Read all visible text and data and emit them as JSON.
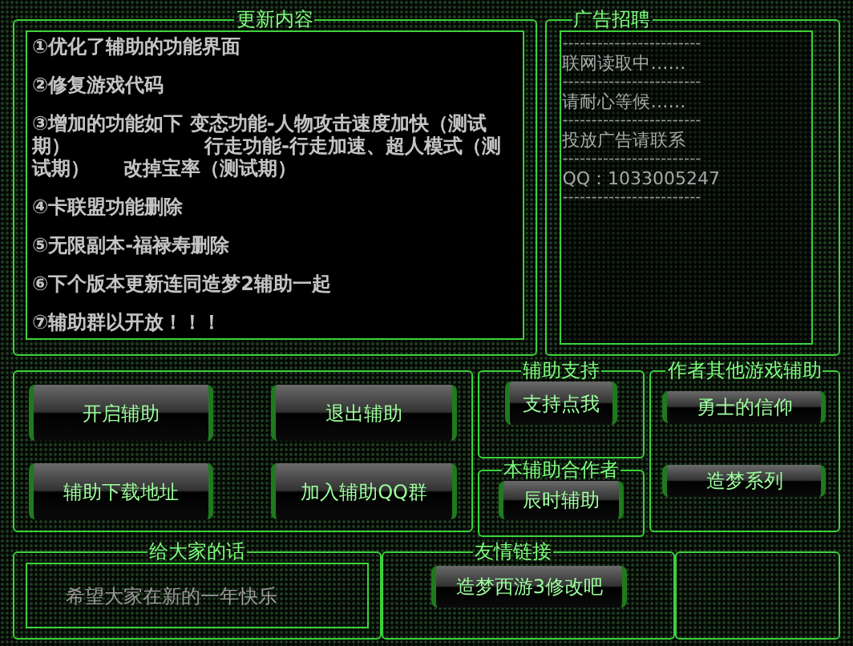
{
  "update_panel": {
    "title": "更新内容",
    "items": [
      "①优化了辅助的功能界面",
      "②修复游戏代码",
      "③增加的功能如下 变态功能-人物攻击速度加快（测试期）                    行走功能-行走加速、超人模式（测试期）     改掉宝率（测试期）",
      "④卡联盟功能删除",
      "⑤无限副本-福禄寿删除",
      "⑥下个版本更新连同造梦2辅助一起",
      "⑦辅助群以开放！！！"
    ]
  },
  "ad_panel": {
    "title": "广告招聘",
    "lines": [
      {
        "kind": "rule",
        "text": "------------------------"
      },
      {
        "kind": "text",
        "text": "联网读取中……"
      },
      {
        "kind": "rule",
        "text": "------------------------"
      },
      {
        "kind": "text",
        "text": "请耐心等候……"
      },
      {
        "kind": "rule",
        "text": "------------------------"
      },
      {
        "kind": "text",
        "text": "投放广告请联系"
      },
      {
        "kind": "rule",
        "text": "------------------------"
      },
      {
        "kind": "text",
        "text": "QQ：1033005247"
      },
      {
        "kind": "rule",
        "text": "------------------------"
      }
    ]
  },
  "main_buttons": [
    "开启辅助",
    "退出辅助",
    "辅助下载地址",
    "加入辅助QQ群"
  ],
  "support": {
    "title": "辅助支持",
    "button": "支持点我"
  },
  "partner": {
    "title": "本辅助合作者",
    "button": "辰时辅助"
  },
  "other_games": {
    "title": "作者其他游戏辅助",
    "buttons": [
      "勇士的信仰",
      "造梦系列"
    ]
  },
  "message": {
    "title": "给大家的话",
    "text": "希望大家在新的一年快乐"
  },
  "links": {
    "title": "友情链接",
    "buttons": [
      "造梦西游3修改吧"
    ]
  }
}
